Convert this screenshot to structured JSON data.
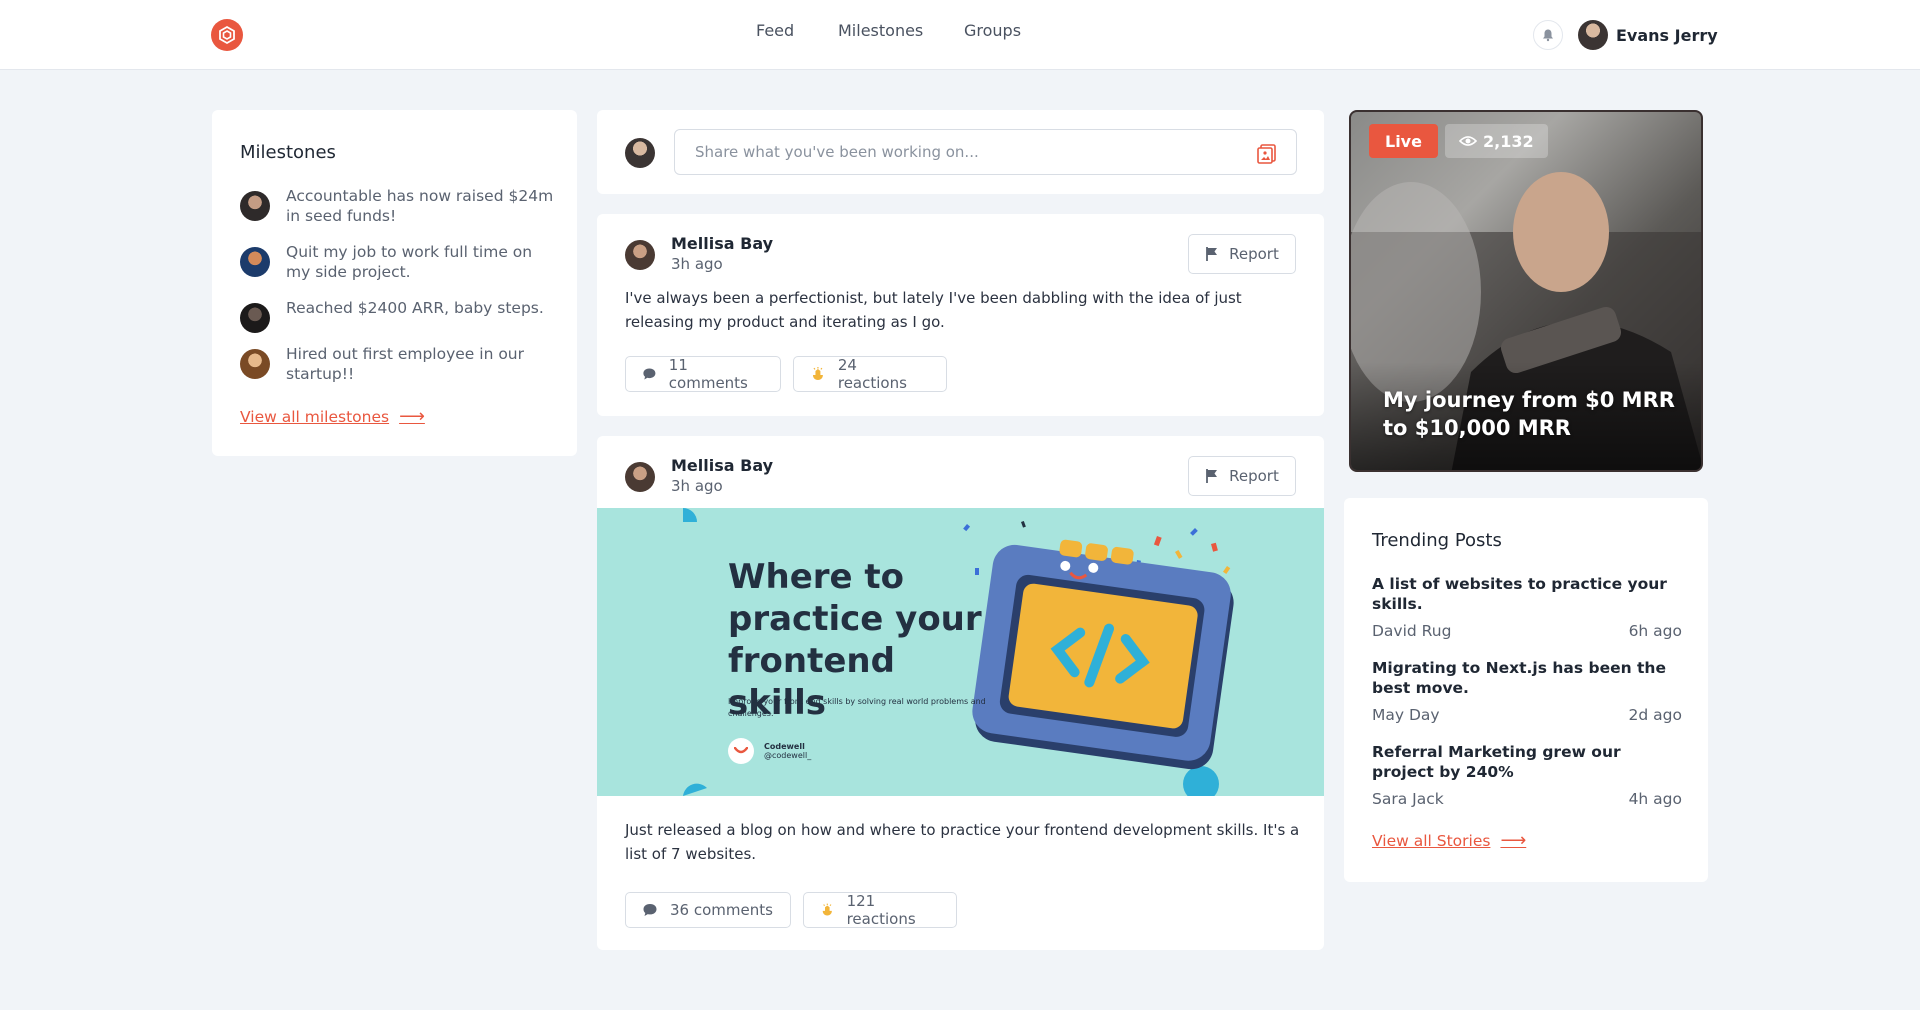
{
  "header": {
    "nav": [
      {
        "label": "Feed"
      },
      {
        "label": "Milestones"
      },
      {
        "label": "Groups"
      }
    ],
    "user_name": "Evans Jerry"
  },
  "milestones": {
    "title": "Milestones",
    "items": [
      {
        "text": "Accountable has now raised $24m in seed funds!"
      },
      {
        "text": "Quit my job to work full time on my side project."
      },
      {
        "text": "Reached $2400 ARR, baby steps."
      },
      {
        "text": "Hired out first employee in our startup!!"
      }
    ],
    "view_all": "View all milestones"
  },
  "composer": {
    "placeholder": "Share what you've been working on..."
  },
  "posts": [
    {
      "author": "Mellisa Bay",
      "time": "3h ago",
      "report_label": "Report",
      "text": "I've always been a perfectionist, but lately I've been dabbling with the idea of just releasing my product and iterating as I go.",
      "comments": "11 comments",
      "reactions": "24 reactions"
    },
    {
      "author": "Mellisa Bay",
      "time": "3h ago",
      "report_label": "Report",
      "banner": {
        "title": "Where to practice your frontend skills",
        "subtitle": "Improve your front end skills by solving real world problems and challenges.",
        "brand": "Codewell",
        "handle": "@codewell_"
      },
      "text": "Just released a blog on how and where to practice your frontend development skills. It's a list of 7 websites.",
      "comments": "36 comments",
      "reactions": "121 reactions"
    }
  ],
  "live": {
    "badge": "Live",
    "views": "2,132",
    "title": "My journey from $0 MRR to $10,000 MRR"
  },
  "trending": {
    "title": "Trending Posts",
    "items": [
      {
        "title": "A list of websites to practice your skills.",
        "author": "David Rug",
        "time": "6h ago"
      },
      {
        "title": "Migrating to Next.js has been the best move.",
        "author": "May Day",
        "time": "2d ago"
      },
      {
        "title": "Referral Marketing grew our project by 240%",
        "author": "Sara Jack",
        "time": "4h ago"
      }
    ],
    "view_all": "View all Stories"
  },
  "colors": {
    "accent": "#e9573f",
    "background": "#f1f4f8",
    "banner_bg": "#a8e4dd"
  }
}
